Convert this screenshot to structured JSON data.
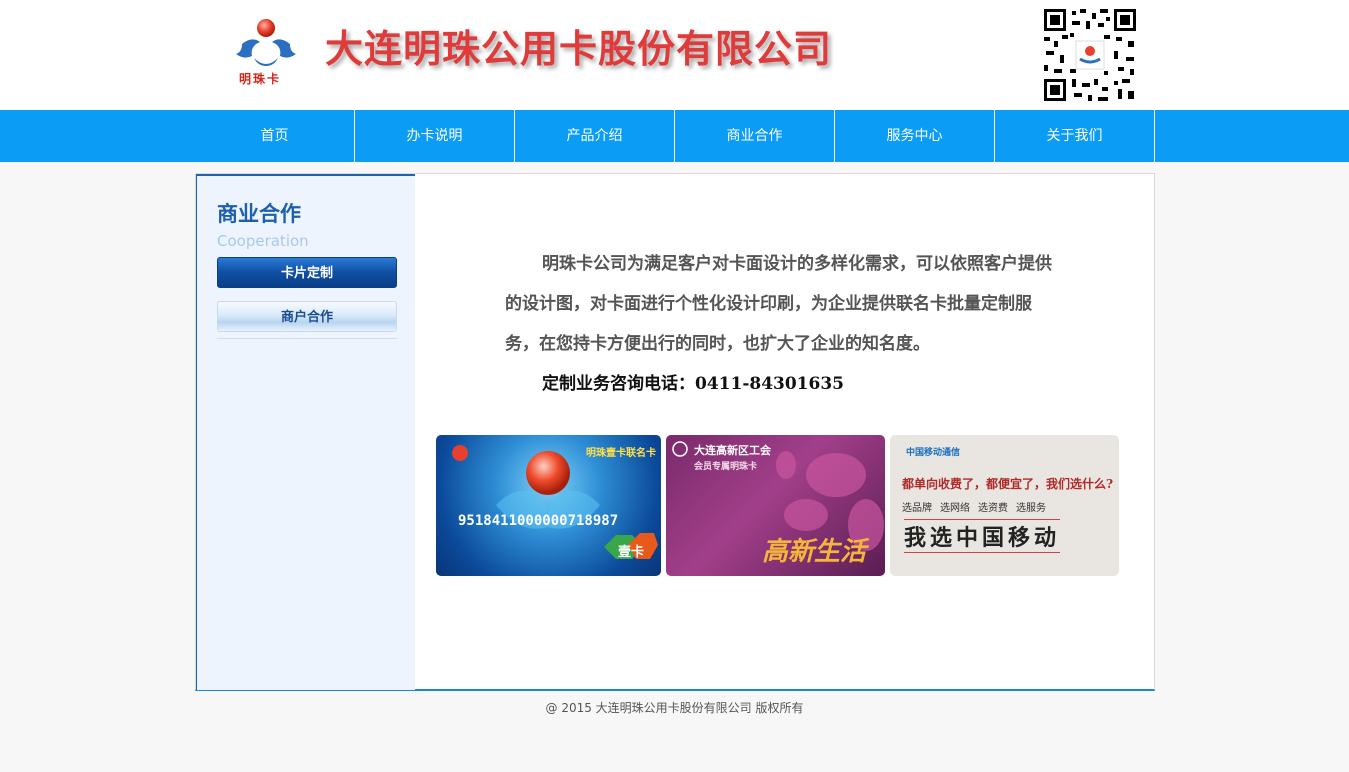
{
  "header": {
    "company_name": "大连明珠公用卡股份有限公司",
    "logo_caption": "明珠卡"
  },
  "nav": {
    "items": [
      "首页",
      "办卡说明",
      "产品介绍",
      "商业合作",
      "服务中心",
      "关于我们"
    ]
  },
  "sidebar": {
    "title": "商业合作",
    "subtitle": "Cooperation",
    "items": [
      {
        "label": "卡片定制",
        "active": true
      },
      {
        "label": "商户合作",
        "active": false
      }
    ]
  },
  "content": {
    "paragraph": "明珠卡公司为满足客户对卡面设计的多样化需求，可以依照客户提供的设计图，对卡面进行个性化设计印刷，为企业提供联名卡批量定制服务，在您持卡方便出行的同时，也扩大了企业的知名度。",
    "phone_line": "定制业务咨询电话：0411-84301635",
    "cards": [
      {
        "title": "明珠壹卡联名卡",
        "number": "9518411000000718987",
        "badge": "壹卡"
      },
      {
        "title": "大连高新区工会",
        "subtitle": "会员专属明珠卡",
        "slogan": "高新生活"
      },
      {
        "brand": "中国移动通信",
        "headline": "都单向收费了，都便宜了，我们选什么?",
        "checks": [
          "选品牌",
          "选网络",
          "选资费",
          "选服务"
        ],
        "slogan": "我选中国移动"
      }
    ]
  },
  "footer": {
    "copyright": "@ 2015 大连明珠公用卡股份有限公司 版权所有"
  },
  "colors": {
    "nav_bg": "#0b9cf5",
    "title_red": "#e03b3b",
    "sidebar_title": "#1b5fae",
    "border_blue": "#1a86d6"
  }
}
